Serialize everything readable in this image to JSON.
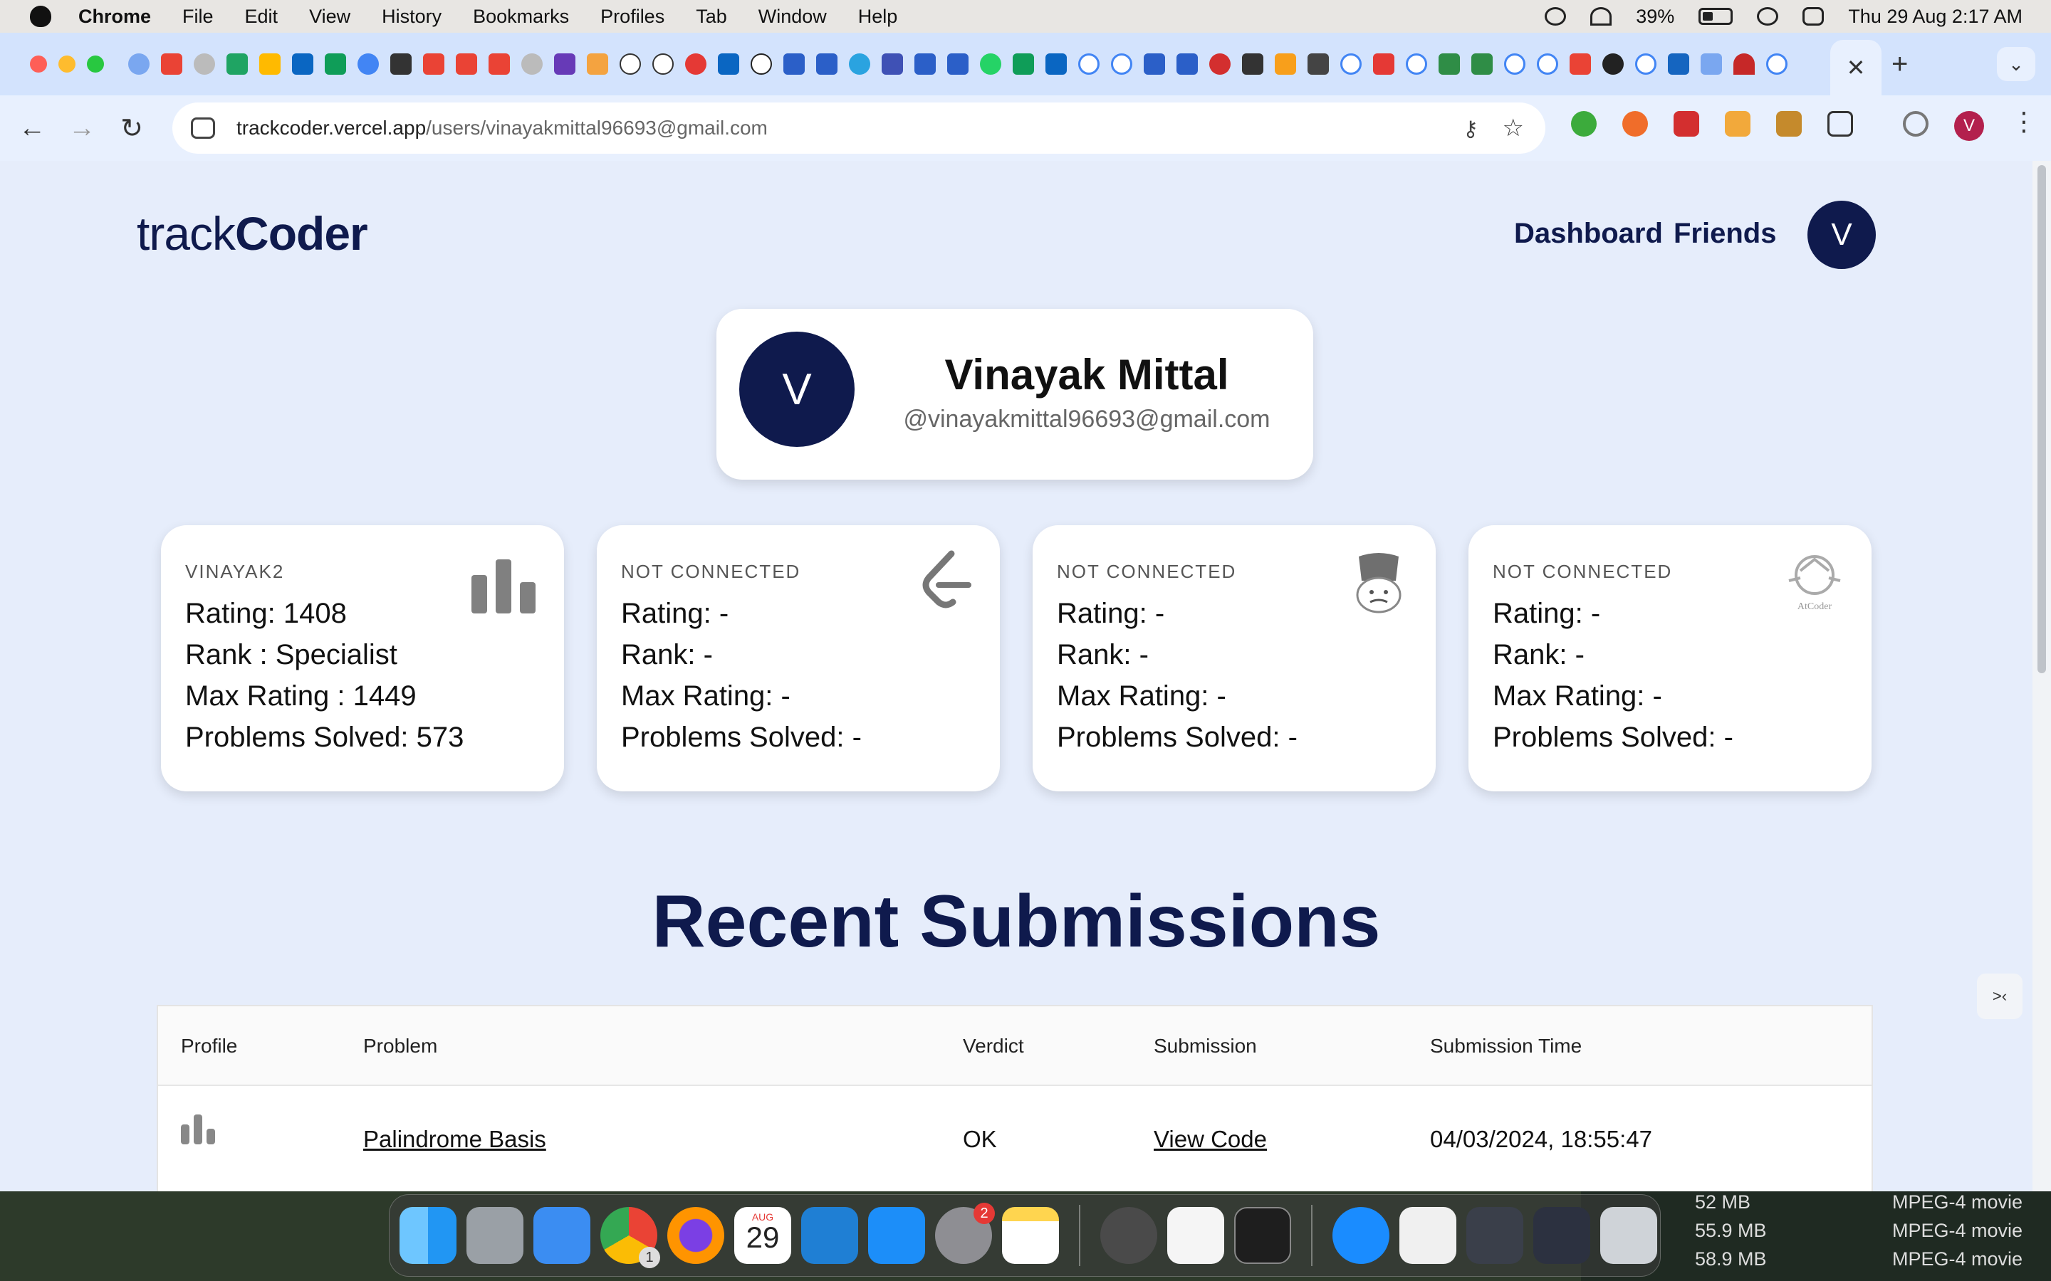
{
  "menubar": {
    "items": [
      "Chrome",
      "File",
      "Edit",
      "View",
      "History",
      "Bookmarks",
      "Profiles",
      "Tab",
      "Window",
      "Help"
    ],
    "battery": "39%",
    "datetime": "Thu 29 Aug  2:17 AM"
  },
  "browser": {
    "close_tab_icon": "✕",
    "new_tab_icon": "+",
    "tab_list_icon": "⌄",
    "url_host": "trackcoder.vercel.app",
    "url_path": "/users/vinayakmittal96693@gmail.com",
    "profile_initial": "V",
    "nav": {
      "back": "←",
      "forward": "→",
      "reload": "↻",
      "key": "⚷",
      "star": "☆",
      "menu": "⋮"
    }
  },
  "site": {
    "logo_light": "track",
    "logo_bold": "Coder",
    "nav_dashboard": "Dashboard",
    "nav_friends": "Friends",
    "avatar_initial": "V"
  },
  "profile": {
    "initial": "V",
    "name": "Vinayak Mittal",
    "email": "@vinayakmittal96693@gmail.com"
  },
  "platforms": [
    {
      "handle": "VINAYAK2",
      "rating": "Rating: 1408",
      "rank": "Rank : Specialist",
      "max_rating": "Max Rating : 1449",
      "solved": "Problems Solved: 573",
      "icon": "codeforces-icon"
    },
    {
      "handle": "NOT CONNECTED",
      "rating": "Rating: -",
      "rank": "Rank: -",
      "max_rating": "Max Rating: -",
      "solved": "Problems Solved: -",
      "icon": "leetcode-icon"
    },
    {
      "handle": "NOT CONNECTED",
      "rating": "Rating: -",
      "rank": "Rank: -",
      "max_rating": "Max Rating: -",
      "solved": "Problems Solved: -",
      "icon": "codechef-icon"
    },
    {
      "handle": "NOT CONNECTED",
      "rating": "Rating: -",
      "rank": "Rank: -",
      "max_rating": "Max Rating: -",
      "solved": "Problems Solved: -",
      "icon": "atcoder-icon",
      "icon_caption": "AtCoder"
    }
  ],
  "submissions": {
    "title": "Recent Submissions",
    "headers": [
      "Profile",
      "Problem",
      "Verdict",
      "Submission",
      "Submission Time"
    ],
    "rows": [
      {
        "profile_icon": "codeforces-icon",
        "problem": "Palindrome Basis",
        "verdict": "OK",
        "submission": "View Code",
        "time": "04/03/2024, 18:55:47"
      }
    ]
  },
  "dock": {
    "calendar_month": "AUG",
    "calendar_day": "29",
    "chrome_badge": "1",
    "settings_badge": "2"
  },
  "finder_files": [
    {
      "size": "52 MB",
      "kind": "MPEG-4 movie"
    },
    {
      "size": "55.9 MB",
      "kind": "MPEG-4 movie"
    },
    {
      "size": "58.9 MB",
      "kind": "MPEG-4 movie"
    }
  ],
  "colors": {
    "brand_navy": "#0f1a4d",
    "page_bg": "#e6edfb",
    "tabstrip_bg": "#d3e3fd"
  }
}
